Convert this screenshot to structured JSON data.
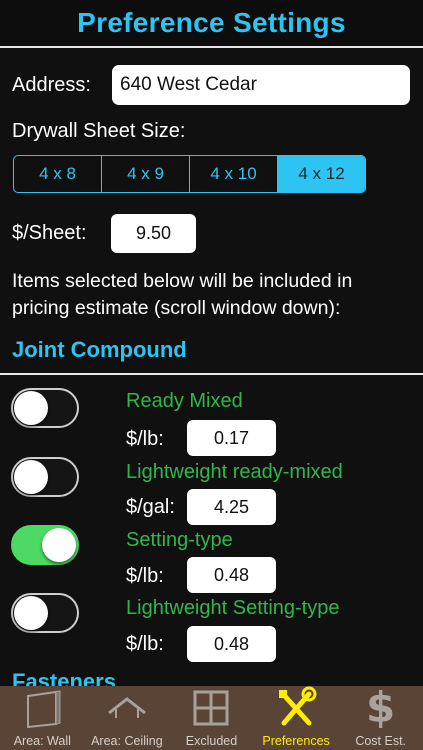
{
  "header": {
    "title": "Preference Settings"
  },
  "address": {
    "label": "Address:",
    "value": "640 West Cedar"
  },
  "drywall": {
    "label": "Drywall Sheet Size:",
    "options": [
      "4 x 8",
      "4 x 9",
      "4 x 10",
      "4 x 12"
    ],
    "selected": "4 x 12"
  },
  "sheet_price": {
    "label": "$/Sheet:",
    "value": "9.50"
  },
  "info_text": "Items selected below will be included in pricing estimate (scroll window down):",
  "sections": {
    "joint_compound": {
      "title": "Joint Compound",
      "items": [
        {
          "name": "Ready Mixed",
          "unit": "$/lb:",
          "price": "0.17",
          "enabled": false
        },
        {
          "name": "Lightweight ready-mixed",
          "unit": "$/gal:",
          "price": "4.25",
          "enabled": false
        },
        {
          "name": "Setting-type",
          "unit": "$/lb:",
          "price": "0.48",
          "enabled": true
        },
        {
          "name": "Lightweight Setting-type",
          "unit": "$/lb:",
          "price": "0.48",
          "enabled": false
        }
      ]
    },
    "fasteners": {
      "title": "Fasteners"
    }
  },
  "tabbar": {
    "tabs": [
      {
        "label": "Area: Wall",
        "icon": "wall-panel-icon"
      },
      {
        "label": "Area: Ceiling",
        "icon": "roof-icon"
      },
      {
        "label": "Excluded",
        "icon": "window-icon"
      },
      {
        "label": "Preferences",
        "icon": "tools-icon"
      },
      {
        "label": "Cost Est.",
        "icon": "dollar-icon"
      }
    ],
    "active": "Preferences",
    "dollar_glyph": "$"
  },
  "colors": {
    "accent": "#2ec4f2",
    "item_green": "#2fb84a",
    "toggle_on": "#4cd964",
    "tabbar_bg": "#5a4436",
    "tab_active": "#ffee00"
  }
}
